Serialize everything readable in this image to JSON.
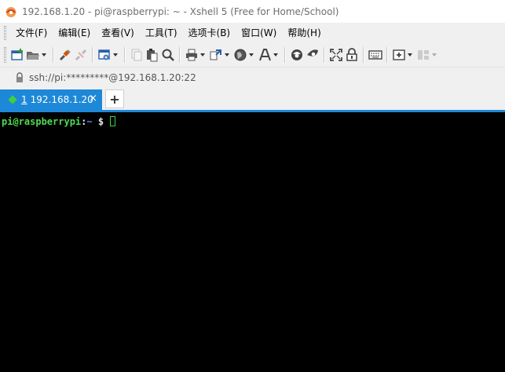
{
  "window": {
    "title": "192.168.1.20 - pi@raspberrypi: ~ - Xshell 5 (Free for Home/School)"
  },
  "menu": {
    "items": [
      "文件(F)",
      "编辑(E)",
      "查看(V)",
      "工具(T)",
      "选项卡(B)",
      "窗口(W)",
      "帮助(H)"
    ]
  },
  "toolbar": {
    "icons": [
      "new-session-icon",
      "open-folder-icon",
      "connect-icon",
      "disconnect-icon",
      "session-properties-icon",
      "copy-icon",
      "paste-icon",
      "find-icon",
      "print-icon",
      "transfer-icon",
      "globe-icon",
      "font-icon",
      "xftp-icon",
      "xmanager-icon",
      "fullscreen-icon",
      "lock-icon",
      "keyboard-icon",
      "new-tab-icon",
      "layout-icon"
    ]
  },
  "address": {
    "text": "ssh://pi:*********@192.168.1.20:22"
  },
  "tabs": [
    {
      "number": "1",
      "label": "192.168.1.20",
      "active": true,
      "close": "×"
    }
  ],
  "tab_add_label": "+",
  "terminal": {
    "user_host": "pi@raspberrypi",
    "colon": ":",
    "path": "~",
    "dollar": " $ "
  },
  "colors": {
    "accent": "#1e88d8",
    "terminal_bg": "#000000",
    "prompt_user": "#4fdc4f",
    "prompt_path": "#5a8cff",
    "session_dot": "#3fcf3f"
  }
}
